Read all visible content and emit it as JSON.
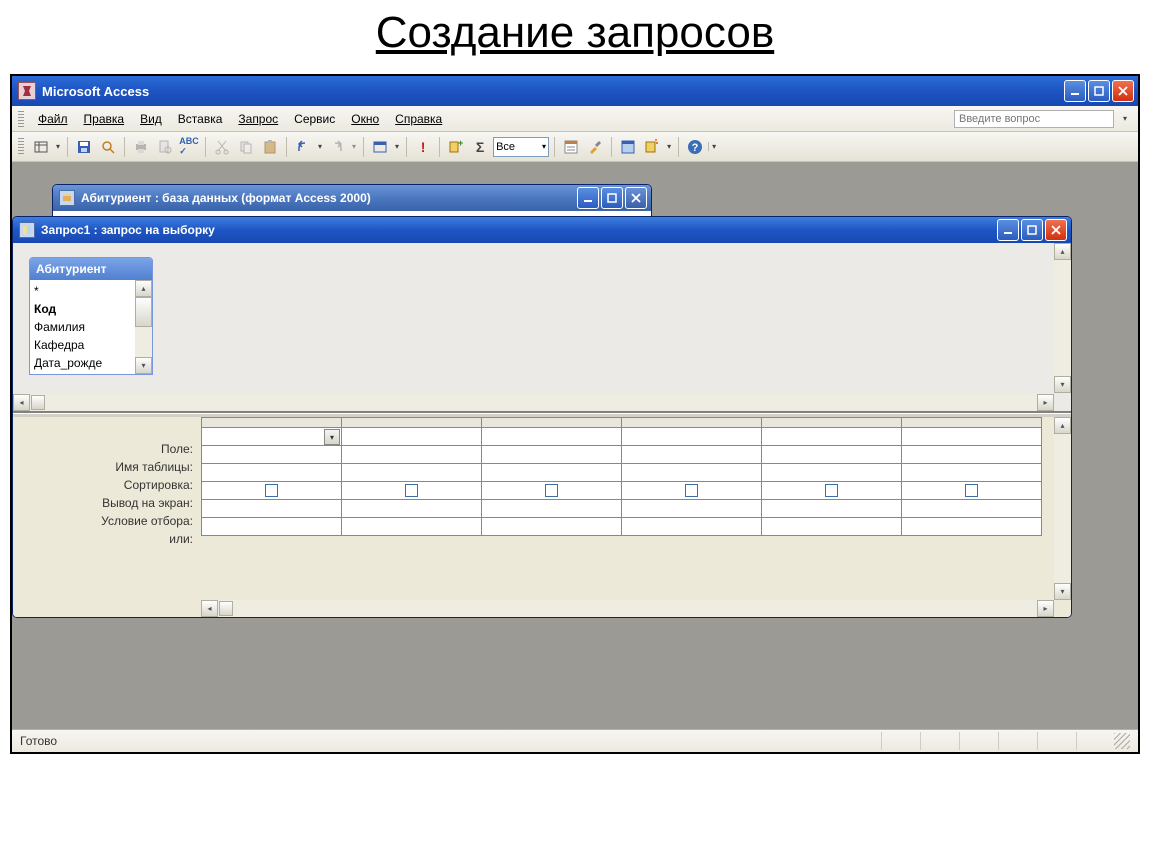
{
  "slide_title": "Создание запросов",
  "app": {
    "title": "Microsoft Access"
  },
  "menu": {
    "file": "Файл",
    "edit": "Правка",
    "view": "Вид",
    "insert": "Вставка",
    "query": "Запрос",
    "tools": "Сервис",
    "window": "Окно",
    "help": "Справка",
    "question_placeholder": "Введите вопрос"
  },
  "toolbar": {
    "all_label": "Все"
  },
  "db_window": {
    "title": "Абитуриент : база данных (формат Access 2000)"
  },
  "query_window": {
    "title": "Запрос1 : запрос на выборку"
  },
  "fieldlist": {
    "title": "Абитуриент",
    "items": [
      "*",
      "Код",
      "Фамилия",
      "Кафедра",
      "Дата_рожде"
    ]
  },
  "qbe": {
    "rows": {
      "field": "Поле:",
      "table": "Имя таблицы:",
      "sort": "Сортировка:",
      "show": "Вывод на экран:",
      "criteria": "Условие отбора:",
      "or": "или:"
    },
    "columns": 6
  },
  "status": "Готово"
}
